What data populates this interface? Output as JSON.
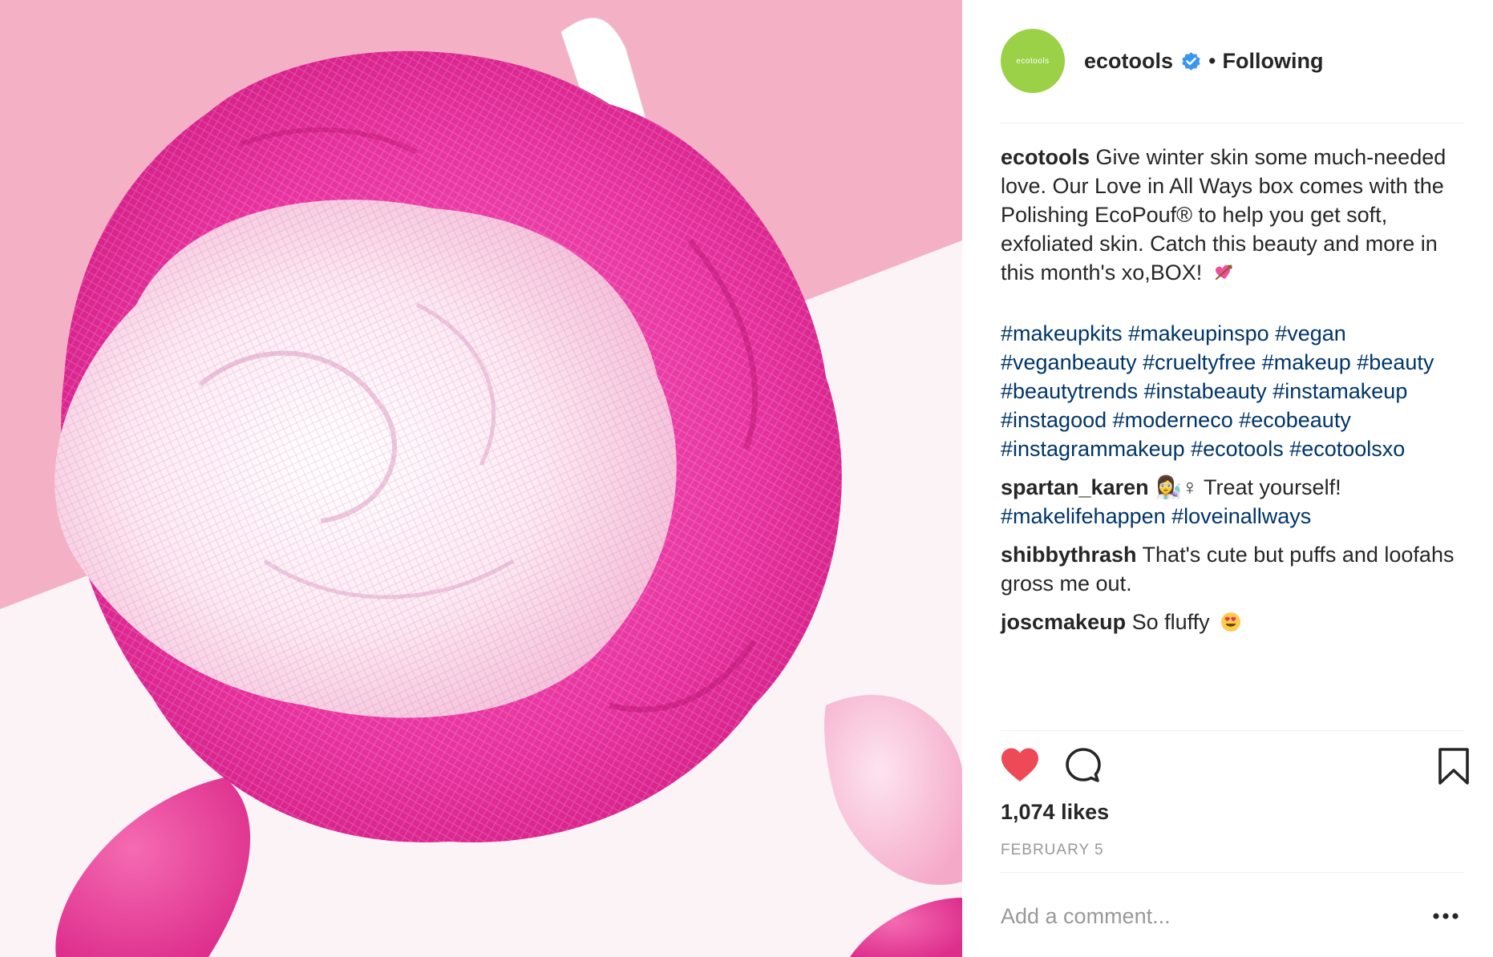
{
  "post": {
    "avatar_text": "ecotools",
    "username": "ecotools",
    "separator": "•",
    "follow_status": "Following",
    "caption": {
      "user": "ecotools",
      "text": "Give winter skin some much-needed love. Our Love in All Ways box comes with the Polishing EcoPouf® to help you get soft, exfoliated skin. Catch this beauty and more in this month's xo,BOX!",
      "emoji": "heart-with-arrow-emoji",
      "hashtags": "#makeupkits #makeupinspo #vegan #veganbeauty #crueltyfree #makeup #beauty #beautytrends #instabeauty #instamakeup #instagood #moderneco #ecobeauty #instagrammakeup #ecotools #ecotoolsxo"
    },
    "comments": [
      {
        "user": "spartan_karen",
        "emoji": "👩‍🔬♀",
        "text": "Treat yourself!",
        "tags": "#makelifehappen #loveinallways"
      },
      {
        "user": "shibbythrash",
        "text": "That's cute but puffs and loofahs gross me out."
      },
      {
        "user": "joscmakeup",
        "text": "So fluffy",
        "emoji": "heart-eyes-emoji"
      }
    ],
    "likes": "1,074 likes",
    "date": "FEBRUARY 5",
    "add_comment_placeholder": "Add a comment...",
    "liked": true
  },
  "colors": {
    "like_red": "#ed4956",
    "link_blue": "#003569",
    "verified_blue": "#3897f0",
    "avatar_green": "#9bd147"
  }
}
